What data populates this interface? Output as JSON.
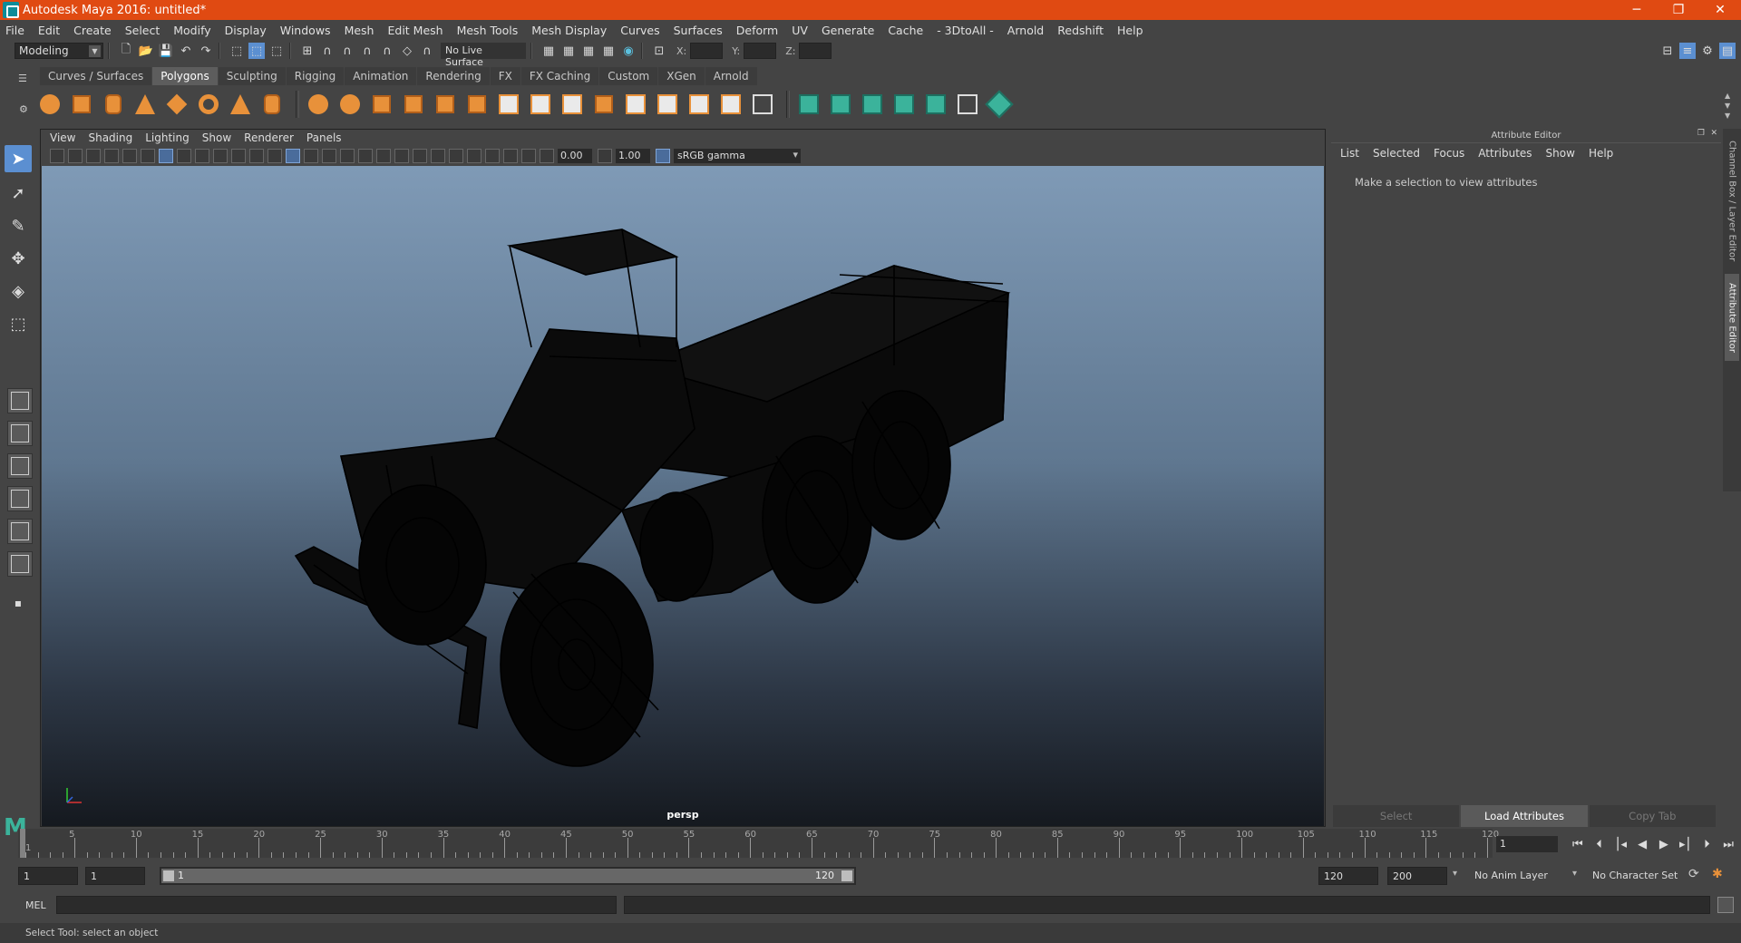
{
  "window": {
    "title": "Autodesk Maya 2016: untitled*",
    "minimize": "─",
    "maximize": "❐",
    "close": "✕"
  },
  "menubar": [
    "File",
    "Edit",
    "Create",
    "Select",
    "Modify",
    "Display",
    "Windows",
    "Mesh",
    "Edit Mesh",
    "Mesh Tools",
    "Mesh Display",
    "Curves",
    "Surfaces",
    "Deform",
    "UV",
    "Generate",
    "Cache",
    "- 3DtoAll -",
    "Arnold",
    "Redshift",
    "Help"
  ],
  "statusline": {
    "mode": "Modeling",
    "live_surface": "No Live Surface",
    "coord_x": "X:",
    "coord_y": "Y:",
    "coord_z": "Z:"
  },
  "shelf_tabs": [
    "Curves / Surfaces",
    "Polygons",
    "Sculpting",
    "Rigging",
    "Animation",
    "Rendering",
    "FX",
    "FX Caching",
    "Custom",
    "XGen",
    "Arnold"
  ],
  "shelf_active_tab": "Polygons",
  "viewport": {
    "menu": [
      "View",
      "Shading",
      "Lighting",
      "Show",
      "Renderer",
      "Panels"
    ],
    "exposure": "0.00",
    "gamma": "1.00",
    "color_space": "sRGB gamma",
    "camera": "persp"
  },
  "attribute_editor": {
    "title": "Attribute Editor",
    "menu": [
      "List",
      "Selected",
      "Focus",
      "Attributes",
      "Show",
      "Help"
    ],
    "message": "Make a selection to view attributes",
    "buttons": [
      "Select",
      "Load Attributes",
      "Copy Tab"
    ]
  },
  "side_tabs": [
    "Channel Box / Layer Editor",
    "Attribute Editor"
  ],
  "timeline": {
    "ticks": [
      5,
      10,
      15,
      20,
      25,
      30,
      35,
      40,
      45,
      50,
      55,
      60,
      65,
      70,
      75,
      80,
      85,
      90,
      95,
      100,
      105,
      110,
      115,
      120
    ],
    "first_label": "1",
    "current_frame": "1",
    "start": 1,
    "end": 120
  },
  "range": {
    "start_time": "1",
    "playback_start": "1",
    "range_start": "1",
    "range_end": "120",
    "playback_end": "120",
    "end_time": "200",
    "anim_layer": "No Anim Layer",
    "character_set": "No Character Set"
  },
  "command_line": {
    "label": "MEL"
  },
  "helpline": "Select Tool: select an object",
  "colors": {
    "titlebar": "#e04a12",
    "accent": "#5b8fd1",
    "shelf_primitive": "#e8913a",
    "shelf_green": "#3bb39b"
  }
}
